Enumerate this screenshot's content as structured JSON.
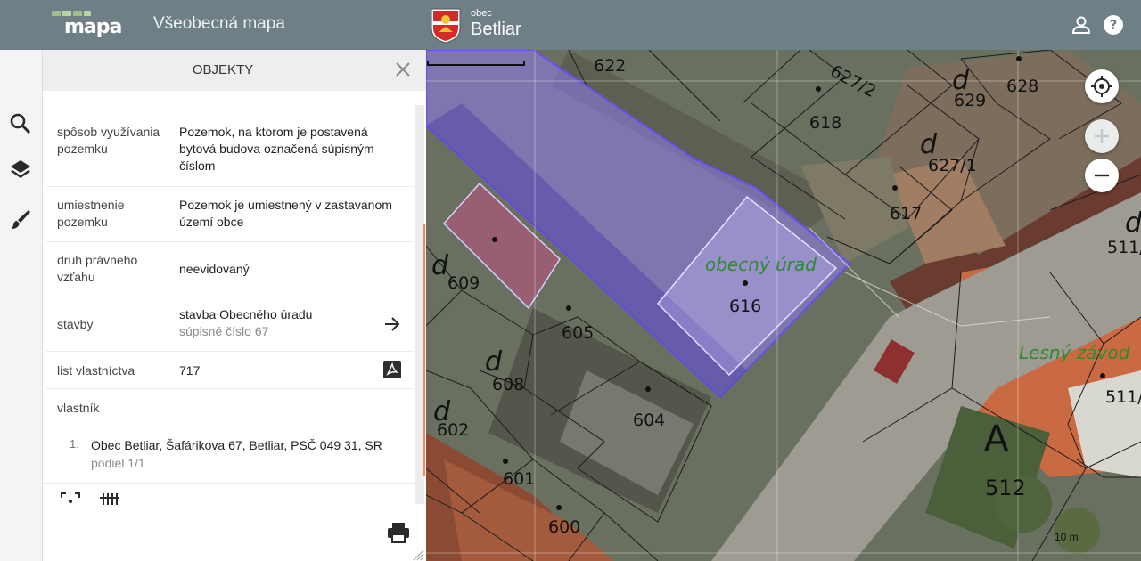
{
  "header": {
    "logo_text": "mapa",
    "map_title": "Všeobecná mapa",
    "municipality_prefix": "obec",
    "municipality_name": "Betliar"
  },
  "panel": {
    "title": "OBJEKTY",
    "rows": [
      {
        "label": "spôsob využívania pozemku",
        "value": "Pozemok, na ktorom je postavená bytová budova označená súpisným číslom"
      },
      {
        "label": "umiestnenie pozemku",
        "value": "Pozemok je umiestnený v zastavanom území obce"
      },
      {
        "label": "druh právneho vzťahu",
        "value": "neevidovaný"
      },
      {
        "label": "stavby",
        "value": "stavba Obecného úradu",
        "subvalue": "súpisné číslo 67"
      },
      {
        "label": "list vlastníctva",
        "value": "717"
      },
      {
        "label": "vlastník"
      }
    ],
    "owner": {
      "number": "1.",
      "name": "Obec Betliar, Šafárikova 67, Betliar, PSČ 049 31, SR",
      "share": "podiel 1/1"
    }
  },
  "map": {
    "parcels": [
      "622",
      "627/2",
      "629",
      "628",
      "618",
      "627/1",
      "617",
      "511/",
      "609",
      "616",
      "605",
      "608",
      "604",
      "602",
      "601",
      "600",
      "512",
      "511/1"
    ],
    "land_use_letters": [
      "d",
      "d",
      "d",
      "d",
      "d",
      "d",
      "A"
    ],
    "labels": {
      "office": "obecný úrad",
      "forest": "Lesný závod"
    },
    "scale_label": "10 m"
  },
  "icons": {
    "search": "search-icon",
    "layers": "layers-icon",
    "brush": "brush-icon",
    "user": "user-icon",
    "help": "help-icon",
    "close": "close-icon",
    "arrow": "arrow-right-icon",
    "pdf": "pdf-icon",
    "print": "print-icon",
    "locate": "locate-icon",
    "zoom_in": "zoom-in-icon",
    "zoom_out": "zoom-out-icon"
  },
  "colors": {
    "header": "#6f7f86",
    "accent_scroll": "#f08a5d",
    "selection": "#7b6cf6",
    "map_label_green": "#2e8b2e"
  }
}
